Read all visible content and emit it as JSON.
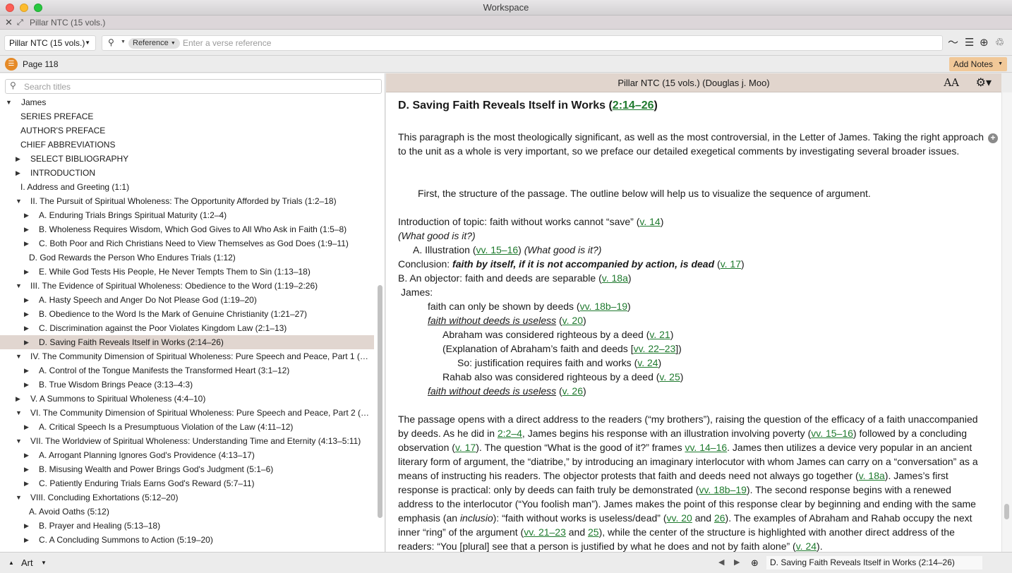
{
  "window": {
    "title": "Workspace"
  },
  "tab": {
    "label": "Pillar NTC (15 vols.)"
  },
  "toolbar": {
    "resource": "Pillar NTC (15 vols.)",
    "search_type": "Reference",
    "verse_placeholder": "Enter a verse reference"
  },
  "pagebar": {
    "page_label": "Page 118",
    "add_notes": "Add Notes"
  },
  "toc": {
    "search_placeholder": "Search titles",
    "items": [
      {
        "label": "James",
        "level": 0,
        "twisty": "open"
      },
      {
        "label": "SERIES PREFACE",
        "level": 1,
        "twisty": "none"
      },
      {
        "label": "AUTHOR'S PREFACE",
        "level": 1,
        "twisty": "none"
      },
      {
        "label": "CHIEF ABBREVIATIONS",
        "level": 1,
        "twisty": "none"
      },
      {
        "label": "SELECT BIBLIOGRAPHY",
        "level": 1,
        "twisty": "closed"
      },
      {
        "label": "INTRODUCTION",
        "level": 1,
        "twisty": "closed"
      },
      {
        "label": "I. Address and Greeting (1:1)",
        "level": 1,
        "twisty": "none"
      },
      {
        "label": "II. The Pursuit of Spiritual Wholeness: The Opportunity Afforded by Trials (1:2–18)",
        "level": 1,
        "twisty": "open"
      },
      {
        "label": "A. Enduring Trials Brings Spiritual Maturity (1:2–4)",
        "level": 2,
        "twisty": "closed"
      },
      {
        "label": "B. Wholeness Requires Wisdom, Which God Gives to All Who Ask in Faith (1:5–8)",
        "level": 2,
        "twisty": "closed"
      },
      {
        "label": "C. Both Poor and Rich Christians Need to View Themselves as God Does (1:9–11)",
        "level": 2,
        "twisty": "closed"
      },
      {
        "label": "D. God Rewards the Person Who Endures Trials (1:12)",
        "level": 2,
        "twisty": "none"
      },
      {
        "label": "E. While God Tests His People, He Never Tempts Them to Sin (1:13–18)",
        "level": 2,
        "twisty": "closed"
      },
      {
        "label": "III. The Evidence of Spiritual Wholeness: Obedience to the Word (1:19–2:26)",
        "level": 1,
        "twisty": "open"
      },
      {
        "label": "A. Hasty Speech and Anger Do Not Please God (1:19–20)",
        "level": 2,
        "twisty": "closed"
      },
      {
        "label": "B. Obedience to the Word Is the Mark of Genuine Christianity (1:21–27)",
        "level": 2,
        "twisty": "closed"
      },
      {
        "label": "C. Discrimination against the Poor Violates Kingdom Law (2:1–13)",
        "level": 2,
        "twisty": "closed"
      },
      {
        "label": "D. Saving Faith Reveals Itself in Works (2:14–26)",
        "level": 2,
        "twisty": "closed",
        "selected": true
      },
      {
        "label": "IV. The Community Dimension of Spiritual Wholeness: Pure Speech and Peace, Part 1 (3:1–…",
        "level": 1,
        "twisty": "open"
      },
      {
        "label": "A. Control of the Tongue Manifests the Transformed Heart (3:1–12)",
        "level": 2,
        "twisty": "closed"
      },
      {
        "label": "B. True Wisdom Brings Peace (3:13–4:3)",
        "level": 2,
        "twisty": "closed"
      },
      {
        "label": "V. A Summons to Spiritual Wholeness (4:4–10)",
        "level": 1,
        "twisty": "closed"
      },
      {
        "label": "VI. The Community Dimension of Spiritual Wholeness: Pure Speech and Peace, Part 2 (4:11…",
        "level": 1,
        "twisty": "open"
      },
      {
        "label": "A. Critical Speech Is a Presumptuous Violation of the Law (4:11–12)",
        "level": 2,
        "twisty": "closed"
      },
      {
        "label": "VII. The Worldview of Spiritual Wholeness: Understanding Time and Eternity (4:13–5:11)",
        "level": 1,
        "twisty": "open"
      },
      {
        "label": "A. Arrogant Planning Ignores God's Providence (4:13–17)",
        "level": 2,
        "twisty": "closed"
      },
      {
        "label": "B. Misusing Wealth and Power Brings God's Judgment (5:1–6)",
        "level": 2,
        "twisty": "closed"
      },
      {
        "label": "C. Patiently Enduring Trials Earns God's Reward (5:7–11)",
        "level": 2,
        "twisty": "closed"
      },
      {
        "label": "VIII. Concluding Exhortations (5:12–20)",
        "level": 1,
        "twisty": "open"
      },
      {
        "label": "A. Avoid Oaths (5:12)",
        "level": 2,
        "twisty": "none"
      },
      {
        "label": "B. Prayer and Healing (5:13–18)",
        "level": 2,
        "twisty": "closed"
      },
      {
        "label": "C. A Concluding Summons to Action (5:19–20)",
        "level": 2,
        "twisty": "closed"
      }
    ]
  },
  "reader": {
    "header": "Pillar NTC (15 vols.) (Douglas j. Moo)",
    "aa": "AA",
    "heading_text": "D. Saving Faith Reveals Itself in Works (",
    "heading_ref": "2:14–26",
    "heading_close": ")",
    "intro": "This paragraph is the most theologically significant, as well as the most controversial, in the Letter of James. Taking the right approach to the unit as a whole is very important, so we preface our detailed exegetical comments by investigating several broader issues.",
    "structure_intro": "First, the structure of the passage. The outline below will help us to visualize the sequence of argument."
  },
  "status": {
    "mode": "Art",
    "location": "D. Saving Faith Reveals Itself in Works (2:14–26)"
  },
  "icons": {
    "close": "close-icon",
    "expand": "expand-icon",
    "search": "search-icon",
    "parallel": "parallel-icon",
    "list": "list-icon",
    "add": "add-icon",
    "recycle": "recycle-icon",
    "gear": "gear-icon",
    "globe": "globe-icon"
  },
  "colors": {
    "link": "#1f7a2e",
    "accent": "#e58a27",
    "add_notes_bg": "#f1c898",
    "selected_row": "#e1d6d0"
  }
}
